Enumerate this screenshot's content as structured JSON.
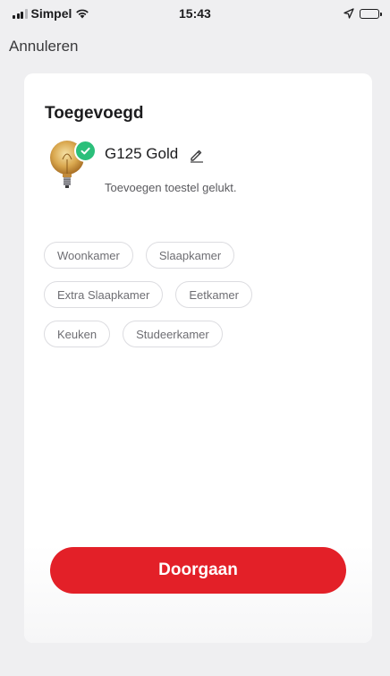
{
  "status_bar": {
    "carrier": "Simpel",
    "time": "15:43"
  },
  "nav": {
    "cancel_label": "Annuleren"
  },
  "card": {
    "title": "Toegevoegd",
    "device": {
      "name": "G125 Gold",
      "status": "Toevoegen toestel gelukt.",
      "icon": "bulb-icon",
      "badge_icon": "check-icon"
    },
    "rooms": [
      [
        "Woonkamer",
        "Slaapkamer"
      ],
      [
        "Extra Slaapkamer",
        "Eetkamer"
      ],
      [
        "Keuken",
        "Studeerkamer"
      ]
    ]
  },
  "primary_button": {
    "label": "Doorgaan"
  },
  "colors": {
    "accent": "#e32028",
    "success": "#2bbf7a",
    "background": "#efeff1"
  }
}
